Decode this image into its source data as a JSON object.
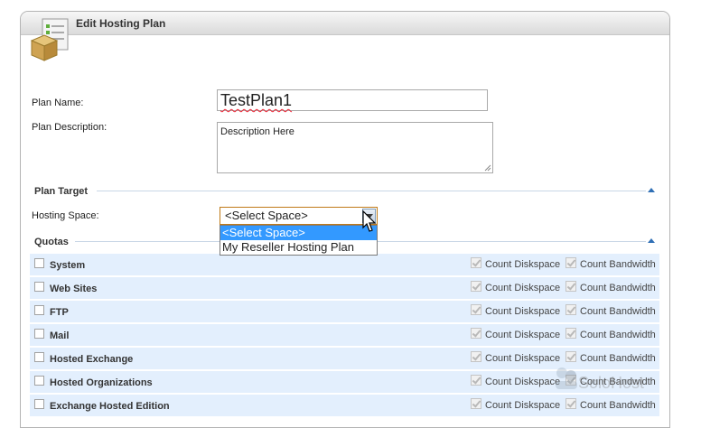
{
  "panel": {
    "title": "Edit Hosting Plan",
    "icon": "plan-box-icon"
  },
  "form": {
    "plan_name_label": "Plan Name:",
    "plan_name_value": "TestPlan1",
    "plan_description_label": "Plan Description:",
    "plan_description_value": "Description Here"
  },
  "plan_target": {
    "title": "Plan Target",
    "hosting_space_label": "Hosting Space:",
    "selected": "<Select Space>",
    "options": [
      "<Select Space>",
      "My Reseller Hosting Plan"
    ]
  },
  "quotas": {
    "title": "Quotas",
    "diskspace_label": "Count Diskspace",
    "bandwidth_label": "Count Bandwidth",
    "rows": [
      {
        "name": "System"
      },
      {
        "name": "Web Sites"
      },
      {
        "name": "FTP"
      },
      {
        "name": "Mail"
      },
      {
        "name": "Hosted Exchange"
      },
      {
        "name": "Hosted Organizations"
      },
      {
        "name": "Exchange Hosted Edition"
      }
    ]
  },
  "watermark": {
    "text": "SoloHost"
  },
  "colors": {
    "accent": "#2f6fb5",
    "row_bg": "#e3effd",
    "select_highlight": "#3399ff"
  }
}
